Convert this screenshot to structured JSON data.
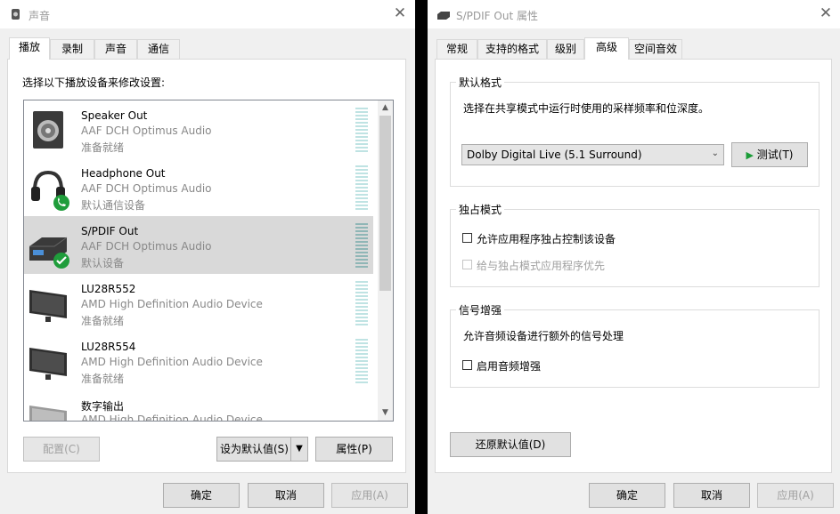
{
  "left_window": {
    "title": "声音",
    "tabs": [
      {
        "label": "播放",
        "active": true
      },
      {
        "label": "录制",
        "active": false
      },
      {
        "label": "声音",
        "active": false
      },
      {
        "label": "通信",
        "active": false
      }
    ],
    "instruction": "选择以下播放设备来修改设置:",
    "devices": [
      {
        "name": "Speaker Out",
        "driver": "AAF DCH Optimus Audio",
        "status": "准备就绪",
        "icon": "speaker-icon",
        "badge": "",
        "selected": false
      },
      {
        "name": "Headphone Out",
        "driver": "AAF DCH Optimus Audio",
        "status": "默认通信设备",
        "icon": "headphone-icon",
        "badge": "phone-badge-icon",
        "selected": false
      },
      {
        "name": "S/PDIF Out",
        "driver": "AAF DCH Optimus Audio",
        "status": "默认设备",
        "icon": "receiver-icon",
        "badge": "check-badge-icon",
        "selected": true
      },
      {
        "name": "LU28R552",
        "driver": "AMD High Definition Audio Device",
        "status": "准备就绪",
        "icon": "monitor-icon",
        "badge": "",
        "selected": false
      },
      {
        "name": "LU28R554",
        "driver": "AMD High Definition Audio Device",
        "status": "准备就绪",
        "icon": "monitor-icon",
        "badge": "",
        "selected": false
      },
      {
        "name": "数字输出",
        "driver": "AMD High Definition Audio Device",
        "status": "",
        "icon": "monitor-icon",
        "badge": "",
        "selected": false
      }
    ],
    "buttons": {
      "configure": "配置(C)",
      "set_default": "设为默认值(S)",
      "properties": "属性(P)",
      "ok": "确定",
      "cancel": "取消",
      "apply": "应用(A)"
    }
  },
  "right_window": {
    "title": "S/PDIF Out 属性",
    "tabs": [
      {
        "label": "常规",
        "active": false
      },
      {
        "label": "支持的格式",
        "active": false
      },
      {
        "label": "级别",
        "active": false
      },
      {
        "label": "高级",
        "active": true
      },
      {
        "label": "空间音效",
        "active": false
      }
    ],
    "default_format": {
      "group_label": "默认格式",
      "description": "选择在共享模式中运行时使用的采样频率和位深度。",
      "selected_format": "Dolby Digital Live (5.1 Surround)",
      "test_button": "测试(T)"
    },
    "exclusive_mode": {
      "group_label": "独占模式",
      "allow_exclusive": "允许应用程序独占控制该设备",
      "allow_exclusive_checked": false,
      "give_priority": "给与独占模式应用程序优先",
      "give_priority_checked": false
    },
    "signal_enhancement": {
      "group_label": "信号增强",
      "description": "允许音频设备进行额外的信号处理",
      "enable_label": "启用音频增强",
      "enable_checked": false
    },
    "buttons": {
      "restore": "还原默认值(D)",
      "ok": "确定",
      "cancel": "取消",
      "apply": "应用(A)"
    }
  },
  "colors": {
    "window_bg": "#f0f0f0",
    "selection": "#d9d9d9",
    "check_green": "#1f9d3b",
    "play_green": "#1a9c37",
    "meter": "#bfe3e3"
  }
}
